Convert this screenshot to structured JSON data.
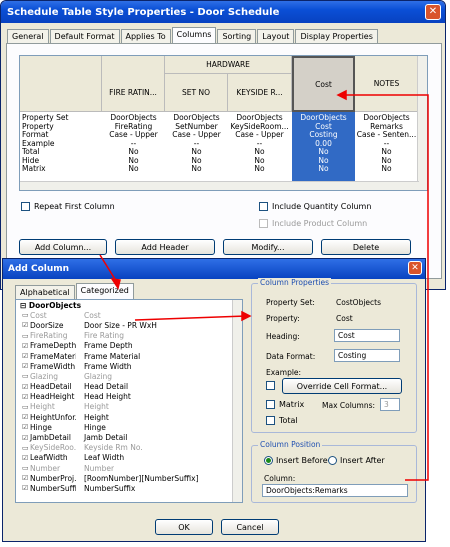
{
  "main_window": {
    "title": "Schedule Table Style Properties - Door Schedule",
    "close": "✕",
    "tabs": [
      "General",
      "Default Format",
      "Applies To",
      "Columns",
      "Sorting",
      "Layout",
      "Display Properties"
    ],
    "headers": {
      "group": "HARDWARE",
      "cols": [
        "FIRE RATIN...",
        "SET NO",
        "KEYSIDE R...",
        "Cost",
        "NOTES"
      ]
    },
    "row_labels": [
      "Property Set",
      "Property",
      "Format",
      "Example",
      "Total",
      "Hide",
      "Matrix"
    ],
    "columns": [
      [
        "DoorObjects",
        "FireRating",
        "Case - Upper",
        "--",
        "No",
        "No",
        "No"
      ],
      [
        "DoorObjects",
        "SetNumber",
        "Case - Upper",
        "--",
        "No",
        "No",
        "No"
      ],
      [
        "DoorObjects",
        "KeySideRoom...",
        "Case - Upper",
        "--",
        "No",
        "No",
        "No"
      ],
      [
        "DoorObjects",
        "Cost",
        "Costing",
        "0.00",
        "No",
        "No",
        "No"
      ],
      [
        "DoorObjects",
        "Remarks",
        "Case - Senten...",
        "--",
        "No",
        "No",
        "No"
      ]
    ],
    "repeat_first": "Repeat First Column",
    "include_qty": "Include Quantity Column",
    "include_product": "Include Product Column",
    "buttons": {
      "add_column": "Add Column...",
      "add_header": "Add Header",
      "modify": "Modify...",
      "delete": "Delete"
    }
  },
  "add_column": {
    "title": "Add Column",
    "close": "✕",
    "tabs": [
      "Alphabetical",
      "Categorized"
    ],
    "tree_root": "DoorObjects",
    "tree": [
      [
        "Cost",
        "Cost",
        1
      ],
      [
        "DoorSize",
        "Door Size - PR WxH",
        0
      ],
      [
        "FireRating",
        "Fire Rating",
        1
      ],
      [
        "FrameDepth",
        "Frame Depth",
        0
      ],
      [
        "FrameMaterial",
        "Frame Material",
        0
      ],
      [
        "FrameWidth",
        "Frame Width",
        0
      ],
      [
        "Glazing",
        "Glazing",
        1
      ],
      [
        "HeadDetail",
        "Head Detail",
        0
      ],
      [
        "HeadHeight",
        "Head Height",
        0
      ],
      [
        "Height",
        "Height",
        1
      ],
      [
        "HeightUnfor...",
        "Height",
        0
      ],
      [
        "Hinge",
        "Hinge",
        0
      ],
      [
        "JambDetail",
        "Jamb Detail",
        0
      ],
      [
        "KeySideRoo...",
        "Keyside Rm No.",
        1
      ],
      [
        "LeafWidth",
        "Leaf Width",
        0
      ],
      [
        "Number",
        "Number",
        1
      ],
      [
        "NumberProj...",
        "[RoomNumber][NumberSuffix]",
        0
      ],
      [
        "NumberSuffix",
        "NumberSuffix",
        0
      ]
    ],
    "col_props": {
      "title": "Column Properties",
      "property_set_label": "Property Set:",
      "property_set": "CostObjects",
      "property_label": "Property:",
      "property": "Cost",
      "heading_label": "Heading:",
      "heading": "Cost",
      "format_label": "Data Format:",
      "format": "Costing",
      "example_label": "Example:",
      "override": "Override Cell Format...",
      "matrix": "Matrix",
      "max_cols_label": "Max Columns:",
      "max_cols": "3",
      "total": "Total"
    },
    "col_pos": {
      "title": "Column Position",
      "insert_before": "Insert Before",
      "insert_after": "Insert After",
      "column_label": "Column:",
      "column": "DoorObjects:Remarks"
    },
    "ok": "OK",
    "cancel": "Cancel"
  }
}
